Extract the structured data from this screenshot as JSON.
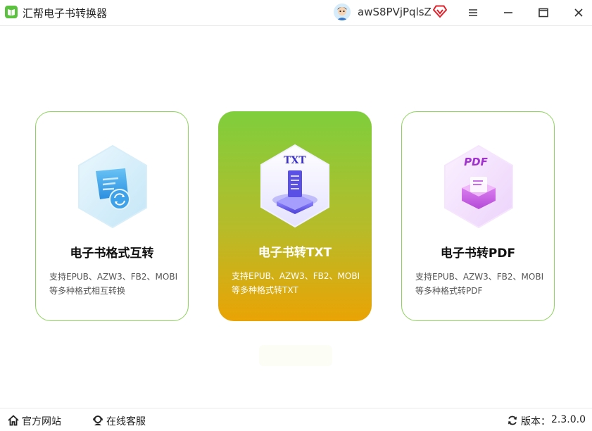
{
  "app": {
    "title": "汇帮电子书转换器"
  },
  "user": {
    "name": "awS8PVjPqlsZ"
  },
  "cards": [
    {
      "title": "电子书格式互转",
      "desc_line1": "支持EPUB、AZW3、FB2、MOBI",
      "desc_line2": "等多种格式相互转换"
    },
    {
      "title": "电子书转TXT",
      "desc_line1": "支持EPUB、AZW3、FB2、MOBI",
      "desc_line2": "等多种格式转TXT",
      "icon_label": "TXT"
    },
    {
      "title": "电子书转PDF",
      "desc_line1": "支持EPUB、AZW3、FB2、MOBI",
      "desc_line2": "等多种格式转PDF",
      "icon_label": "PDF"
    }
  ],
  "footer": {
    "site": "官方网站",
    "service": "在线客服",
    "version_label": "版本：",
    "version": "2.3.0.0"
  },
  "colors": {
    "accent_green": "#5cc13e",
    "card_border": "#8fd35e",
    "active_top": "#7fce3c",
    "active_bottom": "#eaa304"
  },
  "icons": [
    "app-logo-icon",
    "avatar",
    "vip-icon",
    "menu-icon",
    "minimize-icon",
    "maximize-icon",
    "close-icon",
    "format-convert-icon",
    "txt-icon",
    "pdf-icon",
    "home-icon",
    "headset-icon",
    "refresh-icon"
  ]
}
